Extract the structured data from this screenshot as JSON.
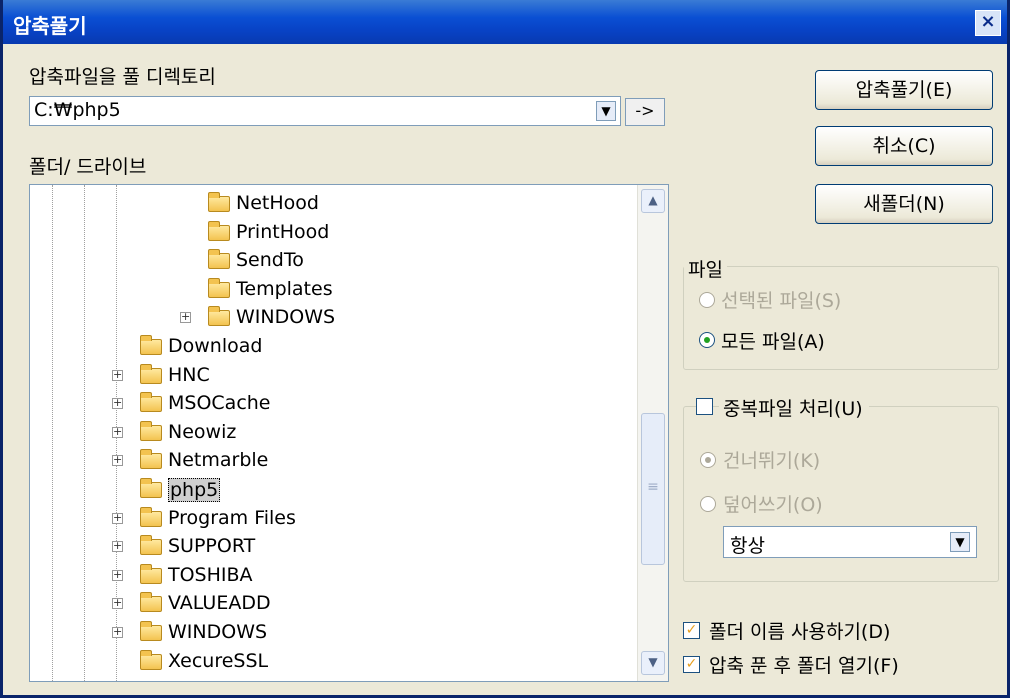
{
  "window": {
    "title": "압축풀기",
    "close_label": "×"
  },
  "target": {
    "label": "압축파일을 풀 디렉토리",
    "path": "C:₩php5",
    "dropdown_glyph": "▼",
    "go_label": "->"
  },
  "tree": {
    "label": "폴더/ 드라이브",
    "items": [
      {
        "name": "NetHood",
        "expand": false,
        "selected": false
      },
      {
        "name": "PrintHood",
        "expand": false,
        "selected": false
      },
      {
        "name": "SendTo",
        "expand": false,
        "selected": false
      },
      {
        "name": "Templates",
        "expand": false,
        "selected": false
      },
      {
        "name": "WINDOWS",
        "expand": true,
        "selected": false
      },
      {
        "name": "Download",
        "expand": false,
        "selected": false
      },
      {
        "name": "HNC",
        "expand": true,
        "selected": false
      },
      {
        "name": "MSOCache",
        "expand": true,
        "selected": false
      },
      {
        "name": "Neowiz",
        "expand": true,
        "selected": false
      },
      {
        "name": "Netmarble",
        "expand": true,
        "selected": false
      },
      {
        "name": "php5",
        "expand": false,
        "selected": true
      },
      {
        "name": "Program Files",
        "expand": true,
        "selected": false
      },
      {
        "name": "SUPPORT",
        "expand": true,
        "selected": false
      },
      {
        "name": "TOSHIBA",
        "expand": true,
        "selected": false
      },
      {
        "name": "VALUEADD",
        "expand": true,
        "selected": false
      },
      {
        "name": "WINDOWS",
        "expand": true,
        "selected": false
      },
      {
        "name": "XecureSSL",
        "expand": false,
        "selected": false
      }
    ],
    "scroll_up": "▲",
    "scroll_down": "▼",
    "scroll_grip": "≡"
  },
  "buttons": {
    "extract": "압축풀기(E)",
    "cancel": "취소(C)",
    "new_folder": "새폴더(N)"
  },
  "files_group": {
    "legend": "파일",
    "selected_files": "선택된 파일(S)",
    "all_files": "모든 파일(A)"
  },
  "duplicate_group": {
    "legend": "중복파일 처리(U)",
    "skip": "건너뛰기(K)",
    "overwrite": "덮어쓰기(O)",
    "mode": "항상"
  },
  "options": {
    "use_folder_name": "폴더 이름 사용하기(D)",
    "open_after": "압축 푼 후 폴더 열기(F)",
    "check_glyph": "✓"
  }
}
